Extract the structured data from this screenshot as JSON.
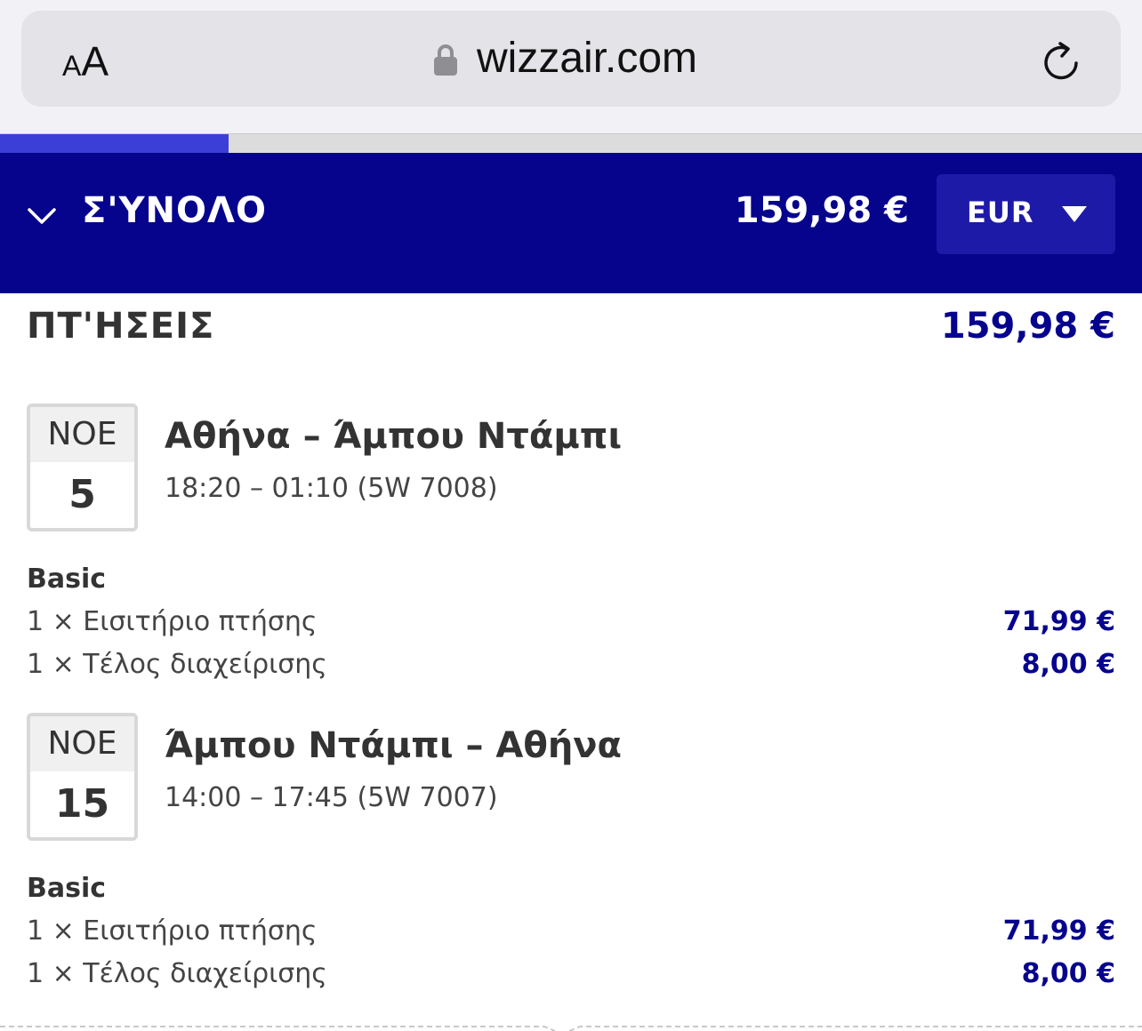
{
  "browser": {
    "text_size_small": "A",
    "text_size_big": "A",
    "url": "wizzair.com",
    "icons": [
      "lock-icon",
      "reload-icon"
    ],
    "load_progress": 0.2
  },
  "summary": {
    "label": "Σ'ΥΝΟΛΟ",
    "total": "159,98 €",
    "currency": "EUR",
    "accent_color": "#06038d"
  },
  "flights_section": {
    "title": "ΠΤ'ΗΣΕΙΣ",
    "total": "159,98 €"
  },
  "flights": [
    {
      "month": "ΝΟΕ",
      "day": "5",
      "route": "Αθήνα – Άμπου Ντάμπι",
      "times": "18:20 – 01:10 (5W 7008)",
      "fare": "Basic",
      "lines": [
        {
          "label": "1 × Εισιτήριο πτήσης",
          "price": "71,99 €"
        },
        {
          "label": "1 × Τέλος διαχείρισης",
          "price": "8,00 €"
        }
      ]
    },
    {
      "month": "ΝΟΕ",
      "day": "15",
      "route": "Άμπου Ντάμπι – Αθήνα",
      "times": "14:00 – 17:45 (5W 7007)",
      "fare": "Basic",
      "lines": [
        {
          "label": "1 × Εισιτήριο πτήσης",
          "price": "71,99 €"
        },
        {
          "label": "1 × Τέλος διαχείρισης",
          "price": "8,00 €"
        }
      ]
    }
  ]
}
